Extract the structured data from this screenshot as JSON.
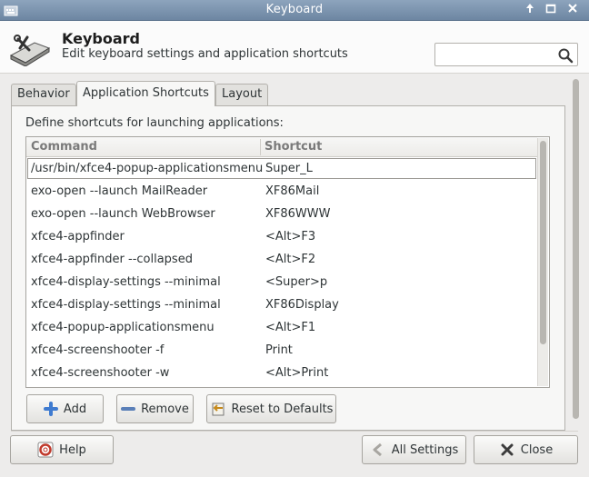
{
  "window": {
    "title": "Keyboard"
  },
  "header": {
    "title": "Keyboard",
    "subtitle": "Edit keyboard settings and application shortcuts",
    "search_placeholder": "",
    "icon": "keyboard-tools-icon"
  },
  "tabs": [
    {
      "label": "Behavior",
      "active": false
    },
    {
      "label": "Application Shortcuts",
      "active": true
    },
    {
      "label": "Layout",
      "active": false
    }
  ],
  "shortcuts": {
    "define_label": "Define shortcuts for launching applications:",
    "columns": {
      "command": "Command",
      "shortcut": "Shortcut"
    },
    "rows": [
      {
        "command": "/usr/bin/xfce4-popup-applicationsmenu",
        "shortcut": "Super_L"
      },
      {
        "command": "exo-open --launch MailReader",
        "shortcut": "XF86Mail"
      },
      {
        "command": "exo-open --launch WebBrowser",
        "shortcut": "XF86WWW"
      },
      {
        "command": "xfce4-appfinder",
        "shortcut": "<Alt>F3"
      },
      {
        "command": "xfce4-appfinder --collapsed",
        "shortcut": "<Alt>F2"
      },
      {
        "command": "xfce4-display-settings --minimal",
        "shortcut": "<Super>p"
      },
      {
        "command": "xfce4-display-settings --minimal",
        "shortcut": "XF86Display"
      },
      {
        "command": "xfce4-popup-applicationsmenu",
        "shortcut": "<Alt>F1"
      },
      {
        "command": "xfce4-screenshooter -f",
        "shortcut": "Print"
      },
      {
        "command": "xfce4-screenshooter -w",
        "shortcut": "<Alt>Print"
      }
    ],
    "add_label": "Add",
    "remove_label": "Remove",
    "reset_label": "Reset to Defaults"
  },
  "footer": {
    "help_label": "Help",
    "all_settings_label": "All Settings",
    "close_label": "Close"
  },
  "colors": {
    "titlebar": "#7a93ae",
    "background": "#edeceb",
    "add_icon": "#3f7bd0"
  }
}
